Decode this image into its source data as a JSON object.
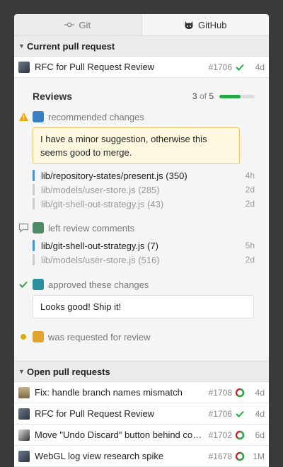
{
  "tabs": [
    {
      "label": "Git",
      "icon": "git-commit-icon",
      "active": false
    },
    {
      "label": "GitHub",
      "icon": "octocat-icon",
      "active": true
    }
  ],
  "current_section": {
    "title": "Current pull request",
    "pr": {
      "title": "RFC for Pull Request Review",
      "number": "#1706",
      "status": "success",
      "age": "4d"
    }
  },
  "reviews": {
    "title": "Reviews",
    "count_done": "3",
    "count_of": "of",
    "count_total": "5",
    "progress": 0.6,
    "items": [
      {
        "state": "changes-requested",
        "action": "recommended changes",
        "comment": "I have a minor suggestion, otherwise this seems good to merge.",
        "files": [
          {
            "name": "lib/repository-states/present.js (350)",
            "age": "4h",
            "active": true
          },
          {
            "name": "lib/models/user-store.js (285)",
            "age": "2d",
            "active": false
          },
          {
            "name": "lib/git-shell-out-strategy.js (43)",
            "age": "2d",
            "active": false
          }
        ]
      },
      {
        "state": "commented",
        "action": "left review comments",
        "files": [
          {
            "name": "lib/git-shell-out-strategy.js (7)",
            "age": "5h",
            "active": true
          },
          {
            "name": "lib/models/user-store.js (516)",
            "age": "2d",
            "active": false
          }
        ]
      },
      {
        "state": "approved",
        "action": "approved these changes",
        "comment": "Looks good! Ship it!"
      },
      {
        "state": "pending",
        "action": "was requested for review"
      }
    ]
  },
  "open_section": {
    "title": "Open pull requests",
    "prs": [
      {
        "title": "Fix: handle branch names mismatch",
        "number": "#1708",
        "status": "pending",
        "age": "4d"
      },
      {
        "title": "RFC for Pull Request Review",
        "number": "#1706",
        "status": "success",
        "age": "4d"
      },
      {
        "title": "Move \"Undo Discard\" button behind context menu",
        "number": "#1702",
        "status": "pending",
        "age": "6d"
      },
      {
        "title": "WebGL log view research spike",
        "number": "#1678",
        "status": "pending",
        "age": "1M"
      }
    ]
  },
  "colors": {
    "success": "#28a745",
    "pending": "#dbab09",
    "failure": "#cb2431",
    "link_bar": "#4a90d9"
  }
}
